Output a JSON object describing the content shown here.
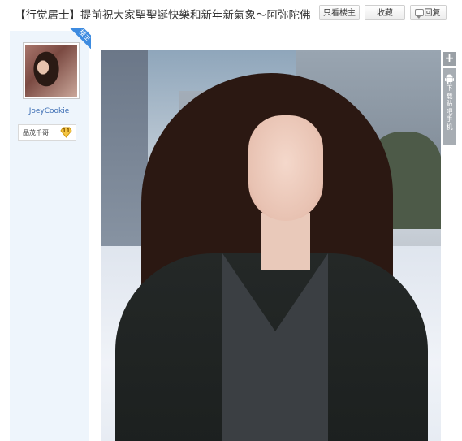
{
  "thread": {
    "title": "【行觉居士】提前祝大家聖聖誕快樂和新年新氣象～阿弥陀佛"
  },
  "header_buttons": {
    "only_op": "只看楼主",
    "favorite": "收藏",
    "reply": "回复"
  },
  "user": {
    "ribbon": "楼主",
    "username": "JoeyCookie",
    "rank_title": "品茂千哥",
    "rank_level": "11"
  },
  "side_toolbar": {
    "plus": "+",
    "app_label": "下载贴吧手机"
  },
  "colors": {
    "link_blue": "#3d6eb4",
    "ribbon_blue": "#3d8be0",
    "user_col_bg": "#eef5fc",
    "badge_gold": "#f4c542"
  },
  "icons": {
    "reply": "comment-icon",
    "level": "diamond-badge-icon",
    "plus": "plus-icon",
    "app": "android-icon"
  }
}
